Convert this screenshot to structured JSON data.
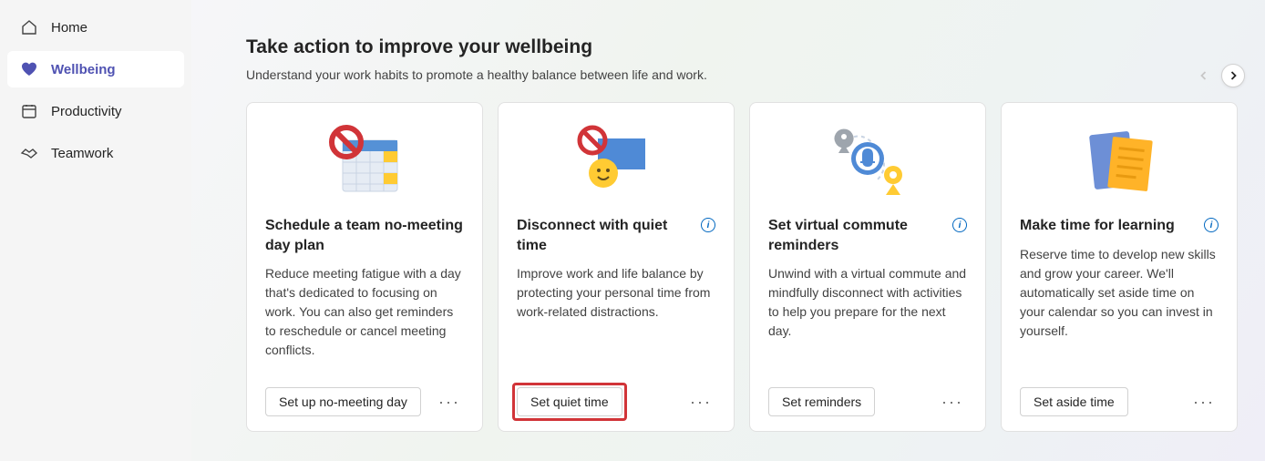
{
  "sidebar": {
    "items": [
      {
        "label": "Home"
      },
      {
        "label": "Wellbeing"
      },
      {
        "label": "Productivity"
      },
      {
        "label": "Teamwork"
      }
    ]
  },
  "header": {
    "title": "Take action to improve your wellbeing",
    "subtitle": "Understand your work habits to promote a healthy balance between life and work."
  },
  "cards": [
    {
      "title": "Schedule a team no-meeting day plan",
      "desc": "Reduce meeting fatigue with a day that's dedicated to focusing on work. You can also get reminders to reschedule or cancel meeting conflicts.",
      "action": "Set up no-meeting day",
      "info": false,
      "highlight": false
    },
    {
      "title": "Disconnect with quiet time",
      "desc": "Improve work and life balance by protecting your personal time from work-related distractions.",
      "action": "Set quiet time",
      "info": true,
      "highlight": true
    },
    {
      "title": "Set virtual commute reminders",
      "desc": "Unwind with a virtual commute and mindfully disconnect with activities to help you prepare for the next day.",
      "action": "Set reminders",
      "info": true,
      "highlight": false
    },
    {
      "title": "Make time for learning",
      "desc": "Reserve time to develop new skills and grow your career. We'll automatically set aside time on your calendar so you can invest in yourself.",
      "action": "Set aside time",
      "info": true,
      "highlight": false
    }
  ]
}
